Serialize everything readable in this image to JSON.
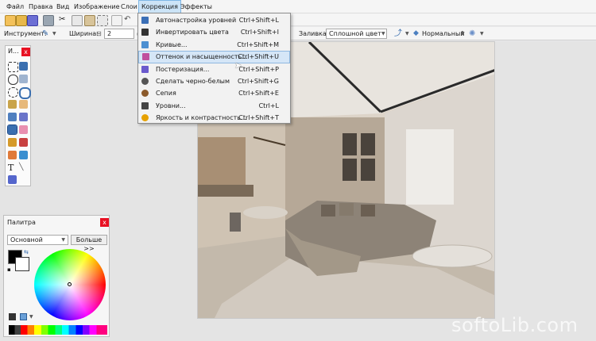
{
  "menubar": {
    "items": [
      {
        "label": "Файл"
      },
      {
        "label": "Правка"
      },
      {
        "label": "Вид"
      },
      {
        "label": "Изображение"
      },
      {
        "label": "Слои"
      },
      {
        "label": "Коррекция"
      },
      {
        "label": "Эффекты"
      }
    ],
    "active": "Коррекция"
  },
  "toolbar": {
    "instrument_label": "Инструмент:",
    "width_label": "Ширина:",
    "width_value": "2",
    "fill_label": "Заливка:",
    "fill_value": "Сплошной цвет",
    "blend_value": "Нормальный",
    "image_tab_dropdown_icon": "chevron-down-icon"
  },
  "correction_menu": {
    "items": [
      {
        "label": "Автонастройка уровней",
        "shortcut": "Ctrl+Shift+L",
        "icon": "auto-level-icon",
        "color": "#3b6fb6"
      },
      {
        "label": "Инвертировать цвета",
        "shortcut": "Ctrl+Shift+I",
        "icon": "invert-colors-icon",
        "color": "#333333"
      },
      {
        "label": "Кривые...",
        "shortcut": "Ctrl+Shift+M",
        "icon": "curves-icon",
        "color": "#4c8fd1"
      },
      {
        "label": "Оттенок и насыщенность...",
        "shortcut": "Ctrl+Shift+U",
        "icon": "hue-saturation-icon",
        "color": "#c0509e",
        "highlighted": true
      },
      {
        "label": "Постеризация...",
        "shortcut": "Ctrl+Shift+P",
        "icon": "posterize-icon",
        "color": "#6a5acd"
      },
      {
        "label": "Сделать черно-белым",
        "shortcut": "Ctrl+Shift+G",
        "icon": "black-white-icon",
        "color": "#555555"
      },
      {
        "label": "Сепия",
        "shortcut": "Ctrl+Shift+E",
        "icon": "sepia-icon",
        "color": "#8b5a2b"
      },
      {
        "label": "Уровни...",
        "shortcut": "Ctrl+L",
        "icon": "levels-icon",
        "color": "#444444"
      },
      {
        "label": "Яркость и контрастность...",
        "shortcut": "Ctrl+Shift+T",
        "icon": "brightness-contrast-icon",
        "color": "#e6a100"
      }
    ]
  },
  "tools_panel": {
    "title": "И...",
    "close": "x"
  },
  "palette": {
    "title": "Палитра",
    "close": "x",
    "mode_value": "Основной",
    "more_button": "Больше >>",
    "primary_color": "#000000",
    "secondary_color": "#ffffff"
  },
  "watermark": "softoLib.com"
}
